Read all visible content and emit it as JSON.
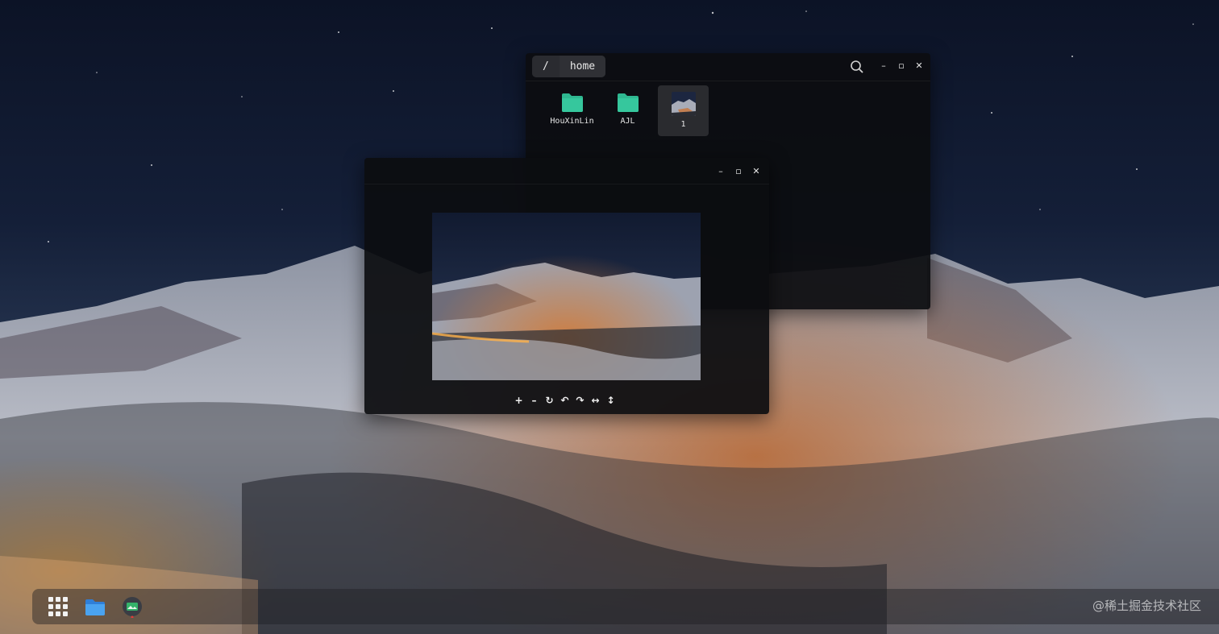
{
  "file_manager": {
    "breadcrumbs": [
      "/",
      "home"
    ],
    "items": [
      {
        "name": "HouXinLin",
        "kind": "folder"
      },
      {
        "name": "AJL",
        "kind": "folder"
      },
      {
        "name": "1",
        "kind": "image"
      }
    ],
    "controls": {
      "minimize": "–",
      "maximize": "▫",
      "close": "✕"
    }
  },
  "image_viewer": {
    "controls": {
      "minimize": "–",
      "maximize": "▫",
      "close": "✕"
    },
    "toolbar": [
      "+",
      "–",
      "↻",
      "↶",
      "↷",
      "↔",
      "↕"
    ]
  },
  "dock": {
    "apps": [
      "app-grid",
      "file-manager",
      "image-viewer"
    ]
  },
  "watermark": "@稀土掘金技术社区",
  "colors": {
    "folder": "#2fb891",
    "dock_files": "#3a8ee6",
    "viewer_icon": "#2d9a5c",
    "indicator": "#e23a3a"
  }
}
